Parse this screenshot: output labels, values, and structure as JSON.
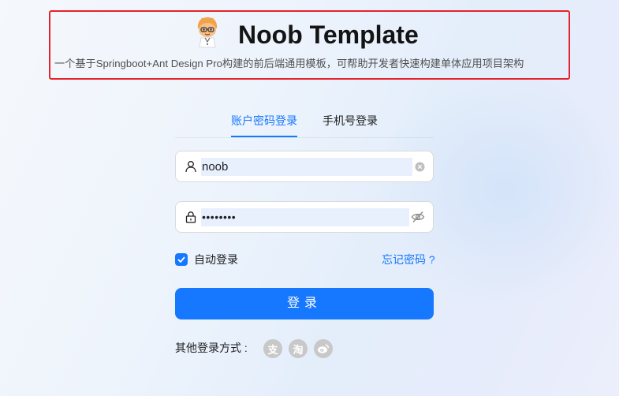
{
  "header": {
    "title": "Noob Template",
    "subtitle": "一个基于Springboot+Ant Design Pro构建的前后端通用模板，可帮助开发者快速构建单体应用项目架构",
    "highlight_color": "#e5232b"
  },
  "tabs": [
    {
      "label": "账户密码登录",
      "active": true
    },
    {
      "label": "手机号登录",
      "active": false
    }
  ],
  "form": {
    "username": {
      "value": "noob",
      "icon": "user-icon",
      "suffix_icon": "clear-icon"
    },
    "password": {
      "value": "••••••••",
      "icon": "lock-icon",
      "suffix_icon": "eye-invisible-icon"
    },
    "remember": {
      "label": "自动登录",
      "checked": true
    },
    "forgot_label": "忘记密码 ?",
    "submit_label": "登录"
  },
  "other_login": {
    "label": "其他登录方式 :",
    "providers": [
      {
        "icon": "alipay-icon",
        "glyph": "支"
      },
      {
        "icon": "taobao-icon",
        "glyph": "淘"
      },
      {
        "icon": "weibo-icon",
        "glyph": ""
      }
    ]
  },
  "colors": {
    "primary": "#1677ff",
    "social_icon_bg": "#c8c8c8"
  }
}
